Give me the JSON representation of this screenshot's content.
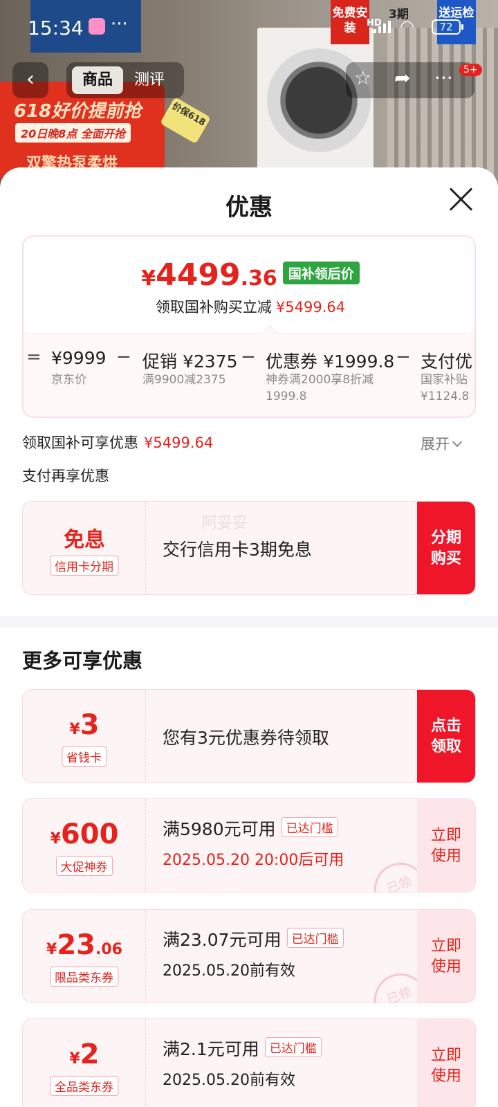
{
  "status_bar": {
    "time": "15:34",
    "network": "HD",
    "battery": "72"
  },
  "background": {
    "promo_line1": "618好价提前抢",
    "promo_line2": "20日晚8点 全面开抢",
    "promo_line3": "双擎热泵柔烘",
    "price_tag": "价保618",
    "badge_install": "免费安装",
    "badge_3": "3期",
    "badge_delivery": "送运检"
  },
  "nav": {
    "tab_product": "商品",
    "tab_review": "测评",
    "notification_count": "5+"
  },
  "sheet": {
    "title": "优惠",
    "summary": {
      "currency": "¥",
      "price_int": "4499",
      "price_dec": ".36",
      "badge": "国补领后价",
      "reduce_text": "领取国补购买立减",
      "reduce_amount": "¥5499.64",
      "calc": {
        "eq": "=",
        "base_price": "¥9999",
        "base_label": "京东价",
        "minus": "−",
        "promo_label": "促销 ¥2375",
        "promo_sub": "满9900减2375",
        "coupon_label": "优惠券 ¥1999.8",
        "coupon_sub_1": "神券满2000享8折减",
        "coupon_sub_2": "1999.8",
        "pay_label": "支付优",
        "pay_sub_1": "国家补贴",
        "pay_sub_2": "¥1124.8"
      }
    },
    "subsidy_label": "领取国补可享优惠",
    "subsidy_amount": "¥5499.64",
    "expand_label": "展开",
    "pay_more_label": "支付再享优惠",
    "watermark": "阿妥妥",
    "installment": {
      "big": "免息",
      "tag": "信用卡分期",
      "text": "交行信用卡3期免息",
      "button": "分期购买"
    },
    "more_title": "更多可享优惠",
    "coupons": [
      {
        "cur": "¥",
        "num": "3",
        "dec": "",
        "tag": "省钱卡",
        "text": "您有3元优惠券待领取",
        "button": "点击领取"
      },
      {
        "cur": "¥",
        "num": "600",
        "dec": "",
        "tag": "大促神券",
        "cond": "满5980元可用",
        "badge": "已达门槛",
        "date": "2025.05.20  20:00后可用",
        "button": "立即使用",
        "stamp": "已领"
      },
      {
        "cur": "¥",
        "num": "23",
        "dec": ".06",
        "tag": "限品类东券",
        "cond": "满23.07元可用",
        "badge": "已达门槛",
        "date": "2025.05.20前有效",
        "button": "立即使用",
        "stamp": "已领"
      },
      {
        "cur": "¥",
        "num": "2",
        "dec": "",
        "tag": "全品类东券",
        "cond": "满2.1元可用",
        "badge": "已达门槛",
        "date": "2025.05.20前有效",
        "button": "立即使用"
      }
    ]
  }
}
